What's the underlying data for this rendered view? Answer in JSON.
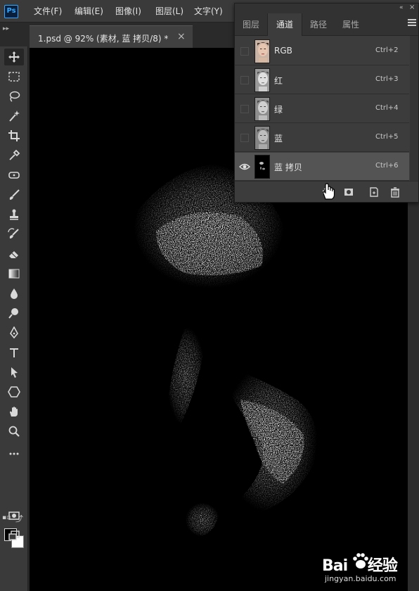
{
  "app": {
    "logo_text": "Ps"
  },
  "menu": {
    "items": [
      {
        "label": "文件(F)"
      },
      {
        "label": "编辑(E)"
      },
      {
        "label": "图像(I)"
      },
      {
        "label": "图层(L)"
      },
      {
        "label": "文字(Y)"
      }
    ]
  },
  "document": {
    "tab_label": "1.psd @ 92% (素材, 蓝 拷贝/8) *",
    "close_glyph": "×"
  },
  "panel": {
    "tabs": [
      {
        "label": "图层",
        "active": false
      },
      {
        "label": "通道",
        "active": true
      },
      {
        "label": "路径",
        "active": false
      },
      {
        "label": "属性",
        "active": false
      }
    ],
    "collapse_glyph": "«",
    "close_glyph": "×",
    "channels": [
      {
        "name": "RGB",
        "shortcut": "Ctrl+2",
        "visible": false,
        "selected": false,
        "thumb": "color-face"
      },
      {
        "name": "红",
        "shortcut": "Ctrl+3",
        "visible": false,
        "selected": false,
        "thumb": "gray-face"
      },
      {
        "name": "绿",
        "shortcut": "Ctrl+4",
        "visible": false,
        "selected": false,
        "thumb": "gray-face"
      },
      {
        "name": "蓝",
        "shortcut": "Ctrl+5",
        "visible": false,
        "selected": false,
        "thumb": "gray-face"
      },
      {
        "name": "蓝 拷贝",
        "shortcut": "Ctrl+6",
        "visible": true,
        "selected": true,
        "thumb": "dark-mask"
      }
    ],
    "footer_buttons": [
      {
        "name": "load-selection-icon"
      },
      {
        "name": "save-selection-icon"
      },
      {
        "name": "new-channel-icon"
      },
      {
        "name": "delete-channel-icon"
      }
    ]
  },
  "tools": [
    "move-tool-icon",
    "marquee-tool-icon",
    "lasso-tool-icon",
    "magic-wand-icon",
    "crop-tool-icon",
    "eyedropper-icon",
    "healing-brush-icon",
    "brush-icon",
    "clone-stamp-icon",
    "history-brush-icon",
    "eraser-icon",
    "gradient-icon",
    "blur-icon",
    "dodge-icon",
    "pen-icon",
    "type-tool-icon",
    "path-selection-icon",
    "shape-tool-icon",
    "hand-tool-icon",
    "zoom-icon",
    "more-tools-icon",
    "quick-mask-icon",
    "screen-mode-icon"
  ],
  "colors": {
    "foreground": "#000000",
    "background": "#ffffff",
    "accent": "#31a8ff"
  },
  "watermark": {
    "brand": "Bai 经验",
    "domain": "jingyan.baidu.com"
  }
}
